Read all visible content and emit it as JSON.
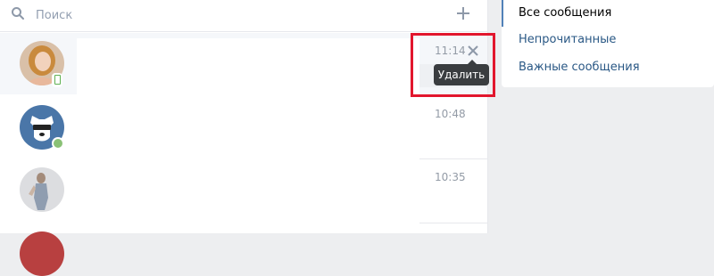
{
  "search": {
    "placeholder": "Поиск"
  },
  "dialogs": [
    {
      "time": "11:14",
      "status": "mobile",
      "delete_tooltip": "Удалить"
    },
    {
      "time": "10:48",
      "status": "online"
    },
    {
      "time": "10:35"
    }
  ],
  "side_menu": {
    "items": [
      {
        "label": "Все сообщения",
        "active": true
      },
      {
        "label": "Непрочитанные"
      },
      {
        "label": "Важные сообщения"
      }
    ]
  },
  "colors": {
    "accent": "#5181b8",
    "link": "#2a5885",
    "online": "#8ac176",
    "highlight": "#e2162d",
    "tooltip_bg": "#3a3d40"
  },
  "icons": [
    "search-icon",
    "plus-icon",
    "close-icon",
    "mobile-icon"
  ]
}
